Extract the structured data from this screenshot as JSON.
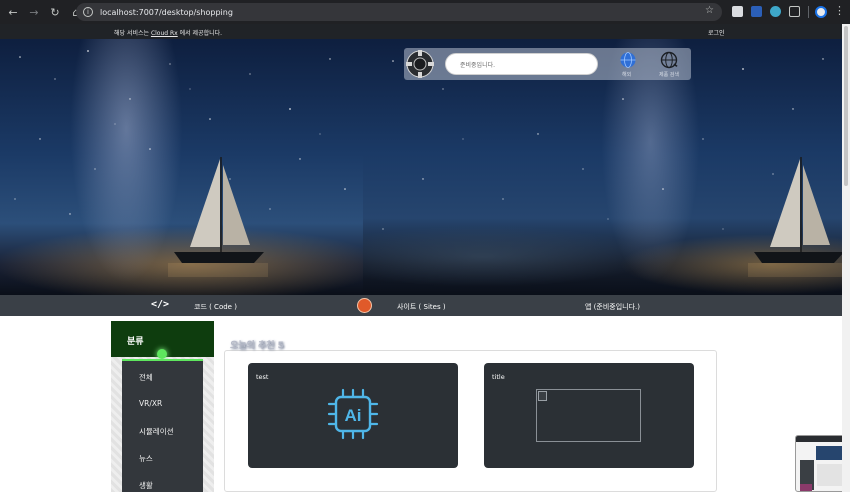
{
  "browser": {
    "url": "localhost:7007/desktop/shopping",
    "back_icon": "arrow-left-icon",
    "forward_icon": "arrow-right-icon",
    "reload_icon": "reload-icon",
    "home_icon": "home-icon"
  },
  "topbar": {
    "notice_prefix": "해당 서비스는 ",
    "notice_link": "Cloud Rx",
    "notice_suffix": " 에서 제공합니다.",
    "login": "로그인"
  },
  "hero": {
    "search_placeholder": "준비중입니다.",
    "icons": [
      {
        "name": "globe-icon",
        "label": "해외"
      },
      {
        "name": "world-search-icon",
        "label": "제품 검색"
      }
    ]
  },
  "categories": [
    {
      "icon": "code-icon",
      "label": "코드 ( Code )"
    },
    {
      "icon": "site-icon",
      "label": "사이트 ( Sites )"
    },
    {
      "icon": "",
      "label": "앱 (준비중입니다.)"
    }
  ],
  "sidebar": {
    "title": "분류",
    "items": [
      "전체",
      "VR/XR",
      "시뮬레이션",
      "뉴스",
      "생활"
    ]
  },
  "recommend": {
    "title": "오늘의 추천 5",
    "cards": [
      {
        "title": "test",
        "image": "ai-chip-icon"
      },
      {
        "title": "title",
        "image": "broken-image"
      }
    ]
  },
  "colors": {
    "accent_green": "#5ee65e",
    "sidebar_header": "#0e3d0e",
    "card_bg": "#2b3035",
    "ai_chip": "#4fb6e8"
  }
}
